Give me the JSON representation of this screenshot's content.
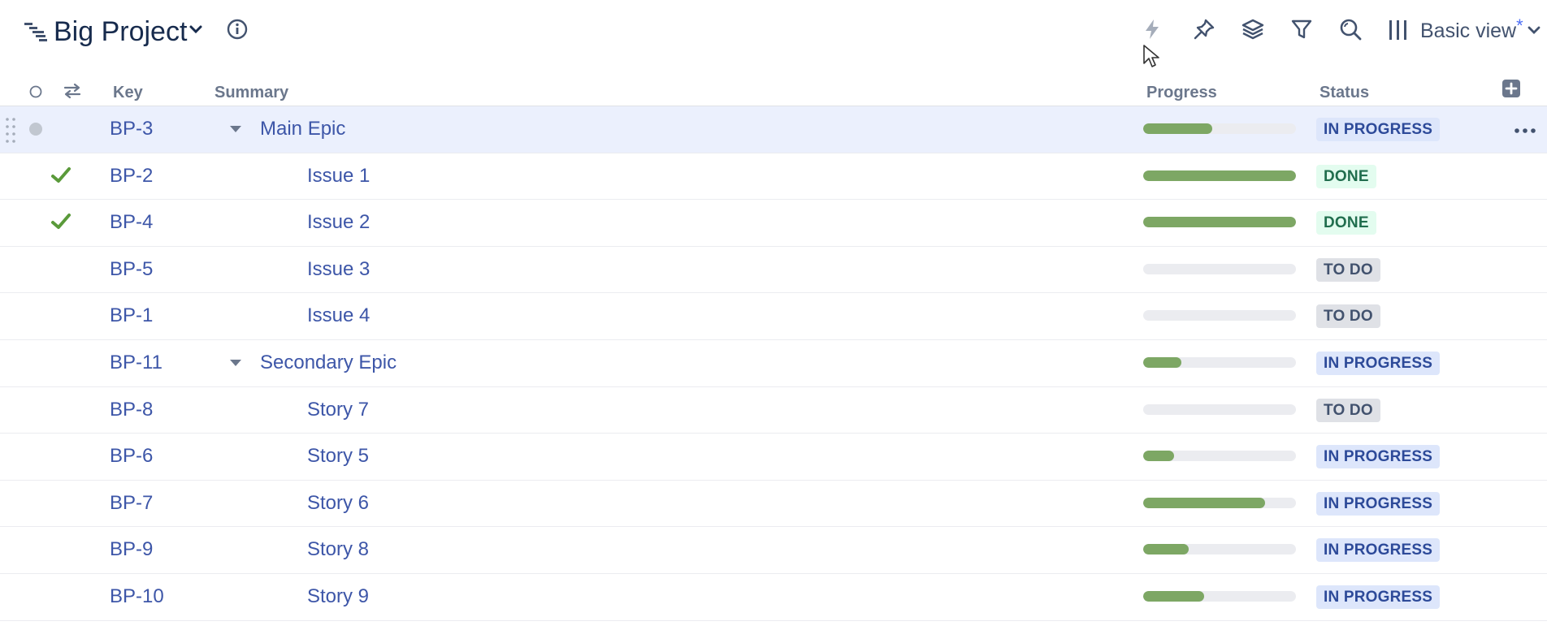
{
  "header": {
    "title": "Big Project",
    "view": {
      "label": "Basic view",
      "modified_marker": "*"
    }
  },
  "columns": {
    "key": "Key",
    "summary": "Summary",
    "progress": "Progress",
    "status": "Status"
  },
  "icons": {
    "project": "hierarchy-icon",
    "title_dropdown": "chevron-down-icon",
    "info": "info-icon",
    "toolbar": [
      "lightning-icon",
      "pin-icon",
      "layers-icon",
      "filter-icon",
      "search-icon",
      "columns-icon"
    ],
    "add_column": "plus-square-icon"
  },
  "colors": {
    "link": "#3d56a8",
    "progress_fill": "#7da764",
    "progress_track": "#ebecf0",
    "selected_row": "#ebf0fd",
    "done_check": "#5a9a3a"
  },
  "rows": [
    {
      "key": "BP-3",
      "summary": "Main Epic",
      "level": 0,
      "expandable": true,
      "progress": 0.45,
      "status": "IN PROGRESS",
      "selected": true,
      "resolved": false
    },
    {
      "key": "BP-2",
      "summary": "Issue 1",
      "level": 1,
      "expandable": false,
      "progress": 1.0,
      "status": "DONE",
      "selected": false,
      "resolved": true
    },
    {
      "key": "BP-4",
      "summary": "Issue 2",
      "level": 1,
      "expandable": false,
      "progress": 1.0,
      "status": "DONE",
      "selected": false,
      "resolved": true
    },
    {
      "key": "BP-5",
      "summary": "Issue 3",
      "level": 1,
      "expandable": false,
      "progress": 0.0,
      "status": "TO DO",
      "selected": false,
      "resolved": false
    },
    {
      "key": "BP-1",
      "summary": "Issue 4",
      "level": 1,
      "expandable": false,
      "progress": 0.0,
      "status": "TO DO",
      "selected": false,
      "resolved": false
    },
    {
      "key": "BP-11",
      "summary": "Secondary Epic",
      "level": 0,
      "expandable": true,
      "progress": 0.25,
      "status": "IN PROGRESS",
      "selected": false,
      "resolved": false
    },
    {
      "key": "BP-8",
      "summary": "Story 7",
      "level": 1,
      "expandable": false,
      "progress": 0.0,
      "status": "TO DO",
      "selected": false,
      "resolved": false
    },
    {
      "key": "BP-6",
      "summary": "Story 5",
      "level": 1,
      "expandable": false,
      "progress": 0.2,
      "status": "IN PROGRESS",
      "selected": false,
      "resolved": false
    },
    {
      "key": "BP-7",
      "summary": "Story 6",
      "level": 1,
      "expandable": false,
      "progress": 0.8,
      "status": "IN PROGRESS",
      "selected": false,
      "resolved": false
    },
    {
      "key": "BP-9",
      "summary": "Story 8",
      "level": 1,
      "expandable": false,
      "progress": 0.3,
      "status": "IN PROGRESS",
      "selected": false,
      "resolved": false
    },
    {
      "key": "BP-10",
      "summary": "Story 9",
      "level": 1,
      "expandable": false,
      "progress": 0.4,
      "status": "IN PROGRESS",
      "selected": false,
      "resolved": false
    }
  ]
}
